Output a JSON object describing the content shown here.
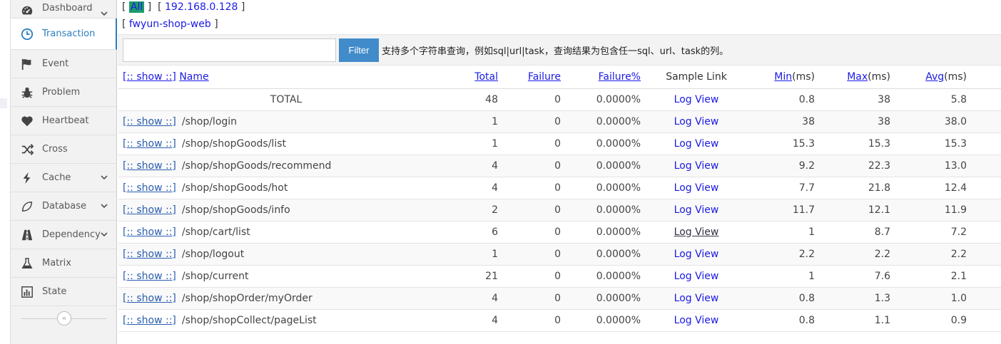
{
  "sidebar": {
    "items": [
      {
        "label": "Dashboard",
        "icon": "dashboard-icon",
        "chevron": true
      },
      {
        "label": "Transaction",
        "icon": "clock-icon",
        "chevron": false,
        "active": true
      },
      {
        "label": "Event",
        "icon": "flag-icon",
        "chevron": false
      },
      {
        "label": "Problem",
        "icon": "bug-icon",
        "chevron": false
      },
      {
        "label": "Heartbeat",
        "icon": "heart-icon",
        "chevron": false
      },
      {
        "label": "Cross",
        "icon": "random-icon",
        "chevron": false
      },
      {
        "label": "Cache",
        "icon": "bolt-icon",
        "chevron": true
      },
      {
        "label": "Database",
        "icon": "leaf-icon",
        "chevron": true
      },
      {
        "label": "Dependency",
        "icon": "road-icon",
        "chevron": true
      },
      {
        "label": "Matrix",
        "icon": "flask-icon",
        "chevron": false
      },
      {
        "label": "State",
        "icon": "bar-chart-icon",
        "chevron": false
      }
    ],
    "collapse_glyph": "«"
  },
  "crumbs": {
    "ips": [
      "All",
      "192.168.0.128"
    ],
    "domain": "fwyun-shop-web"
  },
  "filter": {
    "input_value": "",
    "button_label": "Filter",
    "hint": "支持多个字符串查询，例如sql|url|task，查询结果为包含任一sql、url、task的列。"
  },
  "table": {
    "headers": {
      "name_show": "[:: show ::]",
      "name": "Name",
      "total": "Total",
      "failure": "Failure",
      "failure_pct": "Failure%",
      "sample": "Sample Link",
      "min_link": "Min",
      "min_unit": "(ms)",
      "max_link": "Max",
      "max_unit": "(ms)",
      "avg_link": "Avg",
      "avg_unit": "(ms)"
    },
    "total_row": {
      "name": "TOTAL",
      "total": "48",
      "failure": "0",
      "failure_pct": "0.0000%",
      "sample": "Log View",
      "min": "0.8",
      "max": "38",
      "avg": "5.8"
    },
    "show_label": "[:: show ::]",
    "rows": [
      {
        "name": "/shop/login",
        "total": "1",
        "failure": "0",
        "failure_pct": "0.0000%",
        "sample": "Log View",
        "min": "38",
        "max": "38",
        "avg": "38.0"
      },
      {
        "name": "/shop/shopGoods/list",
        "total": "1",
        "failure": "0",
        "failure_pct": "0.0000%",
        "sample": "Log View",
        "min": "15.3",
        "max": "15.3",
        "avg": "15.3"
      },
      {
        "name": "/shop/shopGoods/recommend",
        "total": "4",
        "failure": "0",
        "failure_pct": "0.0000%",
        "sample": "Log View",
        "min": "9.2",
        "max": "22.3",
        "avg": "13.0"
      },
      {
        "name": "/shop/shopGoods/hot",
        "total": "4",
        "failure": "0",
        "failure_pct": "0.0000%",
        "sample": "Log View",
        "min": "7.7",
        "max": "21.8",
        "avg": "12.4"
      },
      {
        "name": "/shop/shopGoods/info",
        "total": "2",
        "failure": "0",
        "failure_pct": "0.0000%",
        "sample": "Log View",
        "min": "11.7",
        "max": "12.1",
        "avg": "11.9"
      },
      {
        "name": "/shop/cart/list",
        "total": "6",
        "failure": "0",
        "failure_pct": "0.0000%",
        "sample": "Log View",
        "min": "1",
        "max": "8.7",
        "avg": "7.2",
        "hover": true
      },
      {
        "name": "/shop/logout",
        "total": "1",
        "failure": "0",
        "failure_pct": "0.0000%",
        "sample": "Log View",
        "min": "2.2",
        "max": "2.2",
        "avg": "2.2"
      },
      {
        "name": "/shop/current",
        "total": "21",
        "failure": "0",
        "failure_pct": "0.0000%",
        "sample": "Log View",
        "min": "1",
        "max": "7.6",
        "avg": "2.1"
      },
      {
        "name": "/shop/shopOrder/myOrder",
        "total": "4",
        "failure": "0",
        "failure_pct": "0.0000%",
        "sample": "Log View",
        "min": "0.8",
        "max": "1.3",
        "avg": "1.0"
      },
      {
        "name": "/shop/shopCollect/pageList",
        "total": "4",
        "failure": "0",
        "failure_pct": "0.0000%",
        "sample": "Log View",
        "min": "0.8",
        "max": "1.1",
        "avg": "0.9"
      }
    ]
  }
}
